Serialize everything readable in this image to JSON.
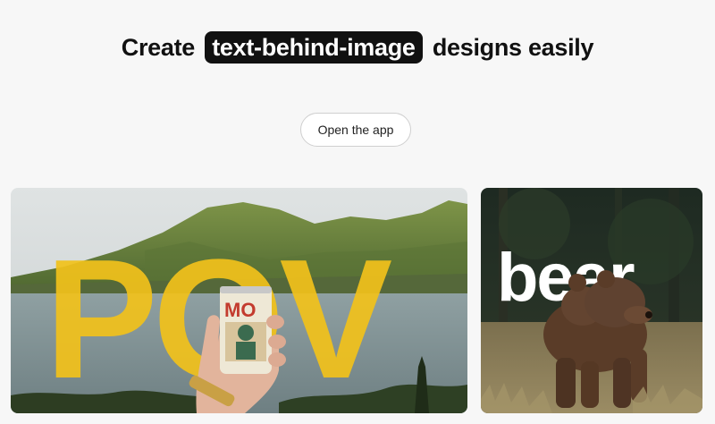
{
  "hero": {
    "title_before": "Create",
    "title_highlight": "text-behind-image",
    "title_after": "designs easily",
    "cta_label": "Open the app"
  },
  "examples": [
    {
      "overlay_text": "POV",
      "can_text": "MO"
    },
    {
      "overlay_text": "bear"
    }
  ],
  "colors": {
    "highlight_bg": "#111111",
    "pov_text": "#f2c21b",
    "bear_text": "#ffffff"
  }
}
